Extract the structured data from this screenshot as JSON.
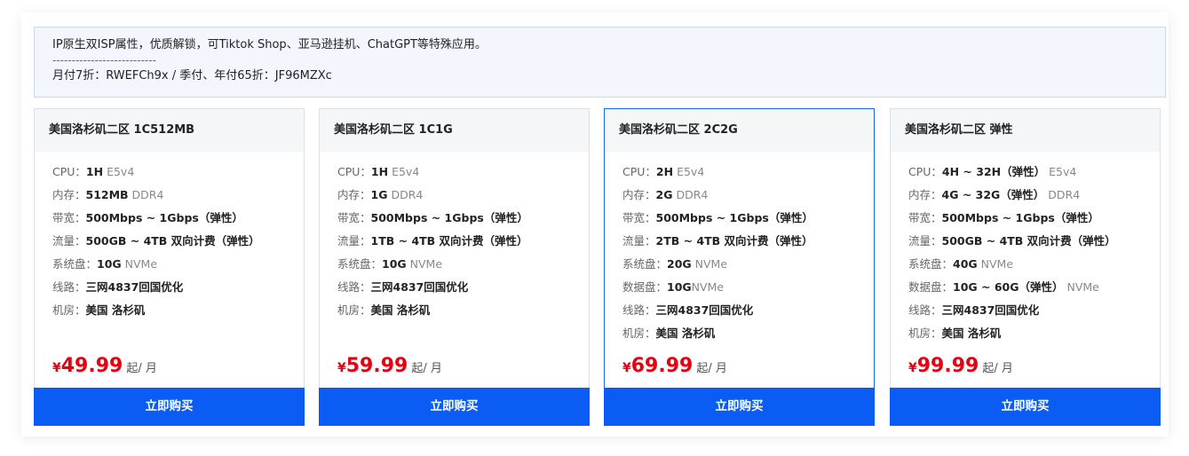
{
  "notice": {
    "line1": "IP原生双ISP属性，优质解锁，可Tiktok Shop、亚马逊挂机、ChatGPT等特殊应用。",
    "divider": "---------------------------",
    "line2": "月付7折：RWEFCh9x / 季付、年付65折：JF96MZXc"
  },
  "colors": {
    "accent": "#0a5cf5",
    "price": "#e60012",
    "active_border": "#1a66d9"
  },
  "cards": [
    {
      "title": "美国洛杉矶二区 1C512MB",
      "specs": [
        {
          "k": "CPU：",
          "v": "1H",
          "s": " E5v4"
        },
        {
          "k": "内存：",
          "v": "512MB",
          "s": " DDR4"
        },
        {
          "k": "带宽：",
          "v": "500Mbps ~ 1Gbps（弹性）",
          "s": ""
        },
        {
          "k": "流量：",
          "v": "500GB ~ 4TB 双向计费（弹性）",
          "s": ""
        },
        {
          "k": "系统盘：",
          "v": "10G",
          "s": " NVMe"
        },
        {
          "k": "线路：",
          "v": "三网4837回国优化",
          "s": ""
        },
        {
          "k": "机房：",
          "v": "美国 洛杉矶",
          "s": ""
        }
      ],
      "currency": "¥",
      "price": "49.99",
      "unit": "起/ 月",
      "button": "立即购买"
    },
    {
      "title": "美国洛杉矶二区 1C1G",
      "specs": [
        {
          "k": "CPU：",
          "v": "1H",
          "s": " E5v4"
        },
        {
          "k": "内存：",
          "v": "1G",
          "s": " DDR4"
        },
        {
          "k": "带宽：",
          "v": "500Mbps ~ 1Gbps（弹性）",
          "s": ""
        },
        {
          "k": "流量：",
          "v": "1TB ~ 4TB 双向计费（弹性）",
          "s": ""
        },
        {
          "k": "系统盘：",
          "v": "10G",
          "s": " NVMe"
        },
        {
          "k": "线路：",
          "v": "三网4837回国优化",
          "s": ""
        },
        {
          "k": "机房：",
          "v": "美国 洛杉矶",
          "s": ""
        }
      ],
      "currency": "¥",
      "price": "59.99",
      "unit": "起/ 月",
      "button": "立即购买"
    },
    {
      "title": "美国洛杉矶二区 2C2G",
      "specs": [
        {
          "k": "CPU：",
          "v": "2H",
          "s": " E5v4"
        },
        {
          "k": "内存：",
          "v": "2G",
          "s": " DDR4"
        },
        {
          "k": "带宽：",
          "v": "500Mbps ~ 1Gbps（弹性）",
          "s": ""
        },
        {
          "k": "流量：",
          "v": "2TB ~ 4TB 双向计费（弹性）",
          "s": ""
        },
        {
          "k": "系统盘：",
          "v": "20G",
          "s": " NVMe"
        },
        {
          "k": "数据盘：",
          "v": "10G",
          "s": "NVMe"
        },
        {
          "k": "线路：",
          "v": "三网4837回国优化",
          "s": ""
        },
        {
          "k": "机房：",
          "v": "美国 洛杉矶",
          "s": ""
        }
      ],
      "currency": "¥",
      "price": "69.99",
      "unit": "起/ 月",
      "button": "立即购买"
    },
    {
      "title": "美国洛杉矶二区 弹性",
      "specs": [
        {
          "k": "CPU：",
          "v": "4H ~ 32H（弹性）",
          "s": " E5v4"
        },
        {
          "k": "内存：",
          "v": "4G ~ 32G（弹性）",
          "s": "  DDR4"
        },
        {
          "k": "带宽：",
          "v": "500Mbps ~ 1Gbps（弹性）",
          "s": ""
        },
        {
          "k": "流量：",
          "v": "500GB ~ 4TB 双向计费（弹性）",
          "s": ""
        },
        {
          "k": "系统盘：",
          "v": "40G",
          "s": " NVMe"
        },
        {
          "k": "数据盘：",
          "v": "10G ~ 60G（弹性）",
          "s": " NVMe"
        },
        {
          "k": "线路：",
          "v": "三网4837回国优化",
          "s": ""
        },
        {
          "k": "机房：",
          "v": "美国 洛杉矶",
          "s": ""
        }
      ],
      "currency": "¥",
      "price": "99.99",
      "unit": "起/ 月",
      "button": "立即购买"
    }
  ]
}
